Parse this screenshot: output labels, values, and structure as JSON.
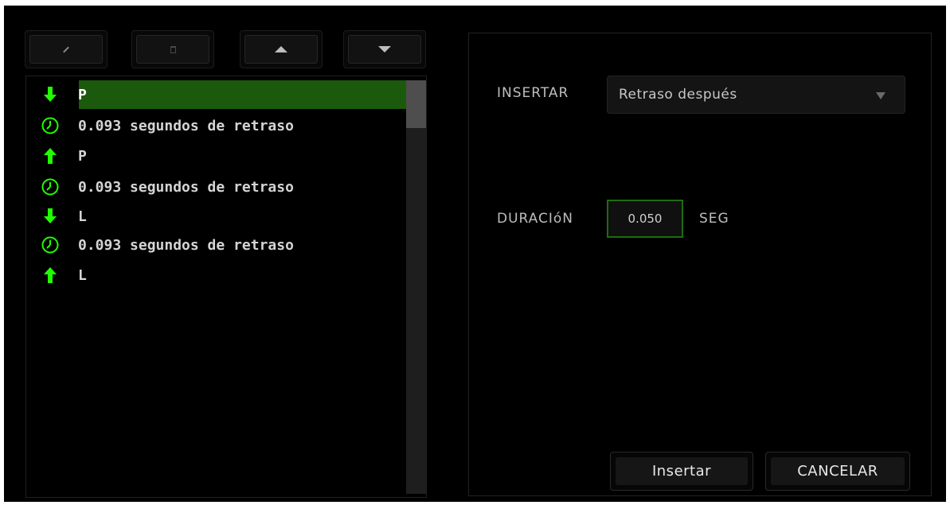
{
  "toolbar": {
    "edit_icon": "pencil-icon",
    "delete_icon": "trash-icon",
    "up_icon": "triangle-up-icon",
    "down_icon": "triangle-down-icon"
  },
  "macro_list": {
    "items": [
      {
        "icon": "key-down-arrow-icon",
        "text": "P",
        "selected": true
      },
      {
        "icon": "clock-icon",
        "text": "0.093 segundos de retraso",
        "selected": false
      },
      {
        "icon": "key-up-arrow-icon",
        "text": "P",
        "selected": false
      },
      {
        "icon": "clock-icon",
        "text": "0.093 segundos de retraso",
        "selected": false
      },
      {
        "icon": "key-down-arrow-icon",
        "text": "L",
        "selected": false
      },
      {
        "icon": "clock-icon",
        "text": "0.093 segundos de retraso",
        "selected": false
      },
      {
        "icon": "key-up-arrow-icon",
        "text": "L",
        "selected": false
      }
    ]
  },
  "dialog": {
    "insert_label": "INSERTAR",
    "insert_select_value": "Retraso después",
    "duration_label": "DURACIóN",
    "duration_value": "0.050",
    "duration_unit": "SEG",
    "insert_button": "Insertar",
    "cancel_button": "CANCELAR"
  },
  "colors": {
    "accent_green": "#21ff00",
    "selection_green": "#1b5a0d",
    "background": "#000000"
  }
}
